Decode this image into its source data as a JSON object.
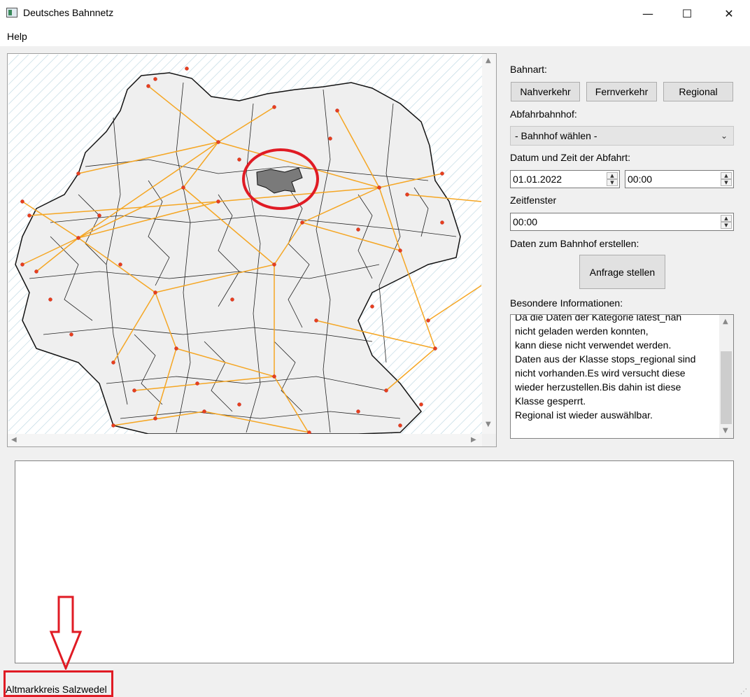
{
  "window": {
    "title": "Deutsches Bahnnetz",
    "minimize_glyph": "—",
    "maximize_glyph": "☐",
    "close_glyph": "✕"
  },
  "menu": {
    "help": "Help"
  },
  "map": {
    "highlight_region": "Altmarkkreis Salzwedel"
  },
  "panel": {
    "bahnart_label": "Bahnart:",
    "buttons": {
      "nahverkehr": "Nahverkehr",
      "fernverkehr": "Fernverkehr",
      "regional": "Regional"
    },
    "abfahr_label": "Abfahrbahnhof:",
    "bahnhof_select": "- Bahnhof wählen -",
    "datum_label": "Datum und Zeit der Abfahrt:",
    "date_value": "01.01.2022",
    "time_value": "00:00",
    "zeitfenster_label": "Zeitfenster",
    "zeitfenster_value": "00:00",
    "daten_label": "Daten zum Bahnhof erstellen:",
    "anfrage_button": "Anfrage stellen",
    "besondere_label": "Besondere Informationen:",
    "info_lines": [
      "Da die Daten der Kategorie latest_nah",
      "nicht geladen werden konnten,",
      "kann diese nicht verwendet werden.",
      "Daten aus der Klasse stops_regional sind",
      "nicht vorhanden.Es wird versucht diese",
      "wieder herzustellen.Bis dahin ist diese",
      "Klasse gesperrt.",
      "Regional ist wieder auswählbar."
    ]
  },
  "status": {
    "text": "Altmarkkreis Salzwedel"
  },
  "colors": {
    "rail": "#f5a623",
    "station": "#e8401c",
    "highlight": "#e01b24",
    "region_fill": "#7a7a7a"
  }
}
